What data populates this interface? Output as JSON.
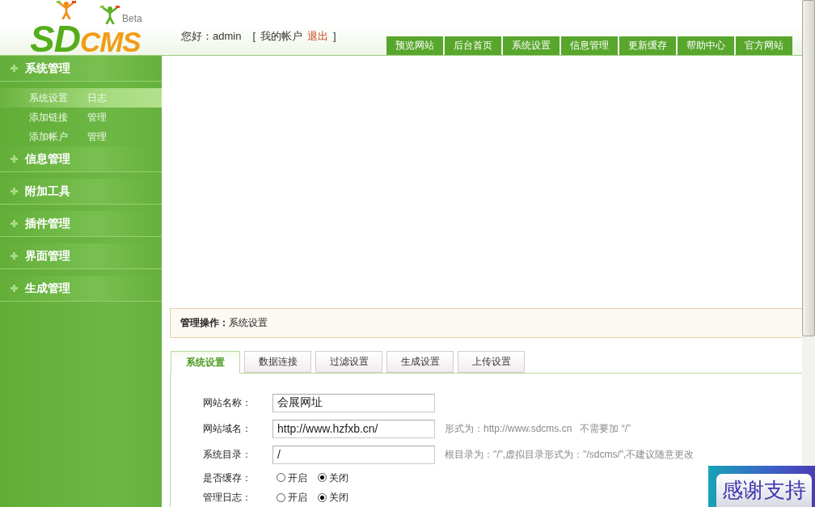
{
  "header": {
    "logo": {
      "parts": [
        "SD",
        "CMS"
      ],
      "badge": "Beta"
    },
    "greeting": "您好：admin",
    "bracket_open": "[",
    "account_link": "我的帐户",
    "logout_link": "退出",
    "bracket_close": "]"
  },
  "top_nav": [
    "预览网站",
    "后台首页",
    "系统设置",
    "信息管理",
    "更新缓存",
    "帮助中心",
    "官方网站"
  ],
  "sidebar": {
    "sections": [
      {
        "title": "系统管理",
        "items": [
          {
            "links": [
              "系统设置",
              "日志"
            ],
            "selected": true
          },
          {
            "links": [
              "添加链接",
              "管理"
            ],
            "selected": false
          },
          {
            "links": [
              "添加帐户",
              "管理"
            ],
            "selected": false
          }
        ]
      },
      {
        "title": "信息管理"
      },
      {
        "title": "附加工具"
      },
      {
        "title": "插件管理"
      },
      {
        "title": "界面管理"
      },
      {
        "title": "生成管理"
      }
    ]
  },
  "breadcrumb": "**管理操作：**系统设置",
  "tabs": [
    {
      "label": "系统设置",
      "selected": true
    },
    {
      "label": "数据连接",
      "selected": false
    },
    {
      "label": "过滤设置",
      "selected": false
    },
    {
      "label": "生成设置",
      "selected": false
    },
    {
      "label": "上传设置",
      "selected": false
    }
  ],
  "form": {
    "rows": [
      {
        "kind": "text",
        "label": "网站名称：",
        "value": "会展网址"
      },
      {
        "kind": "text",
        "label": "网站域名：",
        "value": "http://www.hzfxb.cn/",
        "hint": "形式为：http://www.sdcms.cn   不需要加 “/”"
      },
      {
        "kind": "text",
        "label": "系统目录：",
        "value": "/",
        "hint": "根目录为：\"/\",虚拟目录形式为：\"/sdcms/\",不建议随意更改"
      },
      {
        "kind": "radio",
        "label": "是否缓存：",
        "options": [
          {
            "label": "开启",
            "selected": false
          },
          {
            "label": "关闭",
            "selected": true
          }
        ]
      },
      {
        "kind": "radio",
        "label": "管理日志：",
        "options": [
          {
            "label": "开启",
            "selected": false
          },
          {
            "label": "关闭",
            "selected": true
          }
        ]
      }
    ]
  },
  "support_banner": "感谢支持"
}
